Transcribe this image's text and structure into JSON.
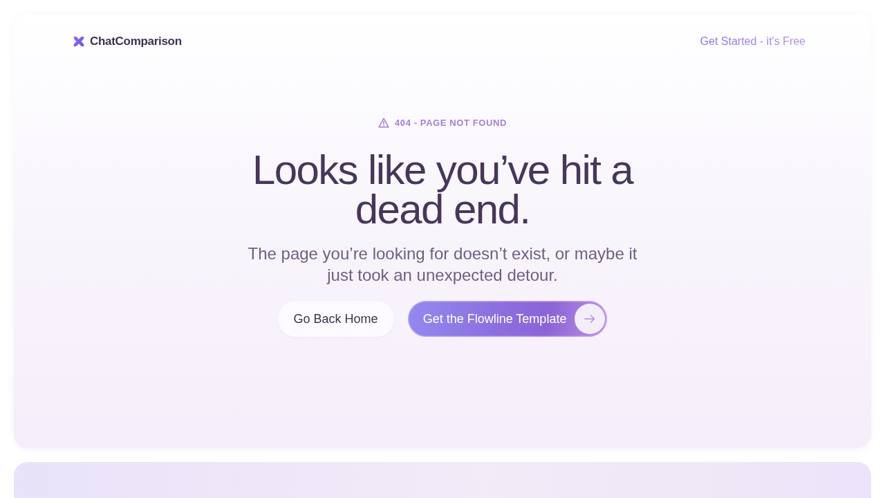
{
  "header": {
    "logo": {
      "text": "ChatComparison"
    },
    "cta": {
      "label": "Get Started - it's Free"
    }
  },
  "hero": {
    "badge": "404 - PAGE NOT FOUND",
    "headline": "Looks like you’ve hit a dead end.",
    "subtitle": "The page you’re looking for doesn’t exist, or maybe it just took an unexpected detour.",
    "buttons": [
      {
        "label": "Go Back Home",
        "kind": "secondary"
      },
      {
        "label": "Get the Flowline Template",
        "kind": "primary"
      }
    ]
  }
}
